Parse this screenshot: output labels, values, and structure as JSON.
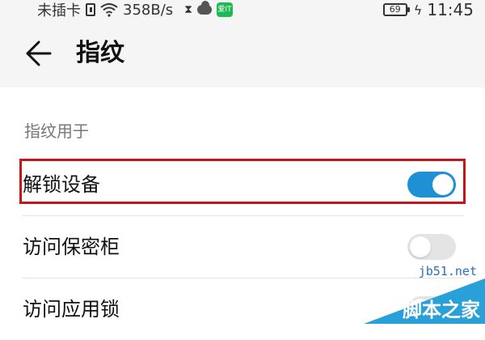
{
  "status_bar": {
    "carrier": "未插卡",
    "net_speed": "358B/s",
    "app_badge": "爱IT",
    "battery": "69",
    "time": "11:45"
  },
  "header": {
    "title": "指纹"
  },
  "section": {
    "label": "指纹用于"
  },
  "items": [
    {
      "label": "解锁设备",
      "toggle_on": true
    },
    {
      "label": "访问保密柜",
      "toggle_on": false
    },
    {
      "label": "访问应用锁",
      "toggle_on": false
    }
  ],
  "colors": {
    "toggle_on": "#1d90d6",
    "toggle_off": "#e4e4e4",
    "highlight": "#c4161c"
  },
  "watermark": {
    "site": "jb51.net",
    "name": "脚本之家"
  }
}
